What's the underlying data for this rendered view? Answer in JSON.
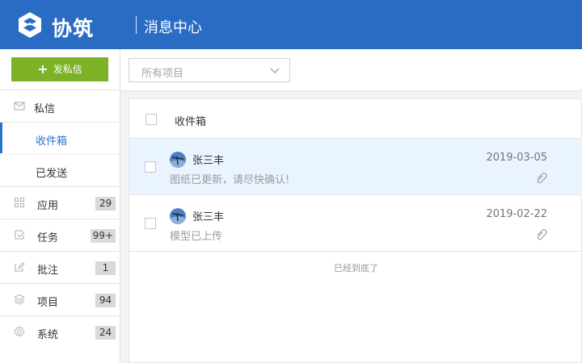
{
  "app": {
    "name": "协筑",
    "page_title": "消息中心"
  },
  "sidebar": {
    "compose_label": "发私信",
    "items": [
      {
        "label": "私信",
        "icon": "envelope-icon"
      },
      {
        "label": "收件箱",
        "active": true
      },
      {
        "label": "已发送"
      },
      {
        "label": "应用",
        "badge": "29",
        "icon": "grid-icon"
      },
      {
        "label": "任务",
        "badge": "99+",
        "icon": "task-check-icon"
      },
      {
        "label": "批注",
        "badge": "1",
        "icon": "edit-note-icon"
      },
      {
        "label": "项目",
        "badge": "94",
        "icon": "layers-icon"
      },
      {
        "label": "系统",
        "badge": "24",
        "icon": "gear-icon"
      }
    ]
  },
  "filter": {
    "project_select_value": "所有项目"
  },
  "list": {
    "header_label": "收件箱",
    "messages": [
      {
        "sender": "张三丰",
        "date": "2019-03-05",
        "body": "图纸已更新，请尽快确认!",
        "selected": true
      },
      {
        "sender": "张三丰",
        "date": "2019-02-22",
        "body": "模型已上传",
        "selected": false
      }
    ],
    "end_note": "已经到底了"
  },
  "colors": {
    "header": "#2a6cc4",
    "compose": "#7db227",
    "active_text": "#2a73cc",
    "selected_row": "#eaf4ff"
  }
}
